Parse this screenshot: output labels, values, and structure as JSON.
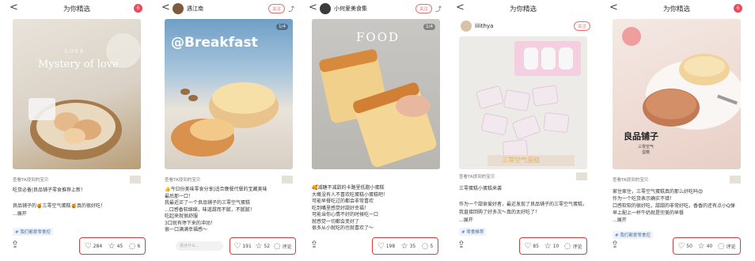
{
  "common": {
    "back": "<",
    "recommend_title": "为你精选"
  },
  "cards": [
    {
      "top_title": "为你精选",
      "badge": "6",
      "photo_text": "Mystery of love",
      "photo_sub": "LOVE",
      "count": "",
      "meta_left": "查看TA提到的宝贝",
      "desc": "吃货必备|良品铺子零食推荐上新！\n\n良品铺子的🍯三零空气蛋糕🍯真的很好吃！\n...展开",
      "tag": "# 我们都爱零食控",
      "likes": "284",
      "stars": "45",
      "comments": "6",
      "comment_placeholder": ""
    },
    {
      "username": "遇江南",
      "follow": "关注",
      "photo_text": "@Breakfast",
      "count": "1/4",
      "meta_left": "查看TA提到的宝贝",
      "desc": "👍今日份美味零食分享|适合晚餐代餐的宝藏美味\n最后那一口！\n我最近买了一个良品铺子的三零空气蛋糕\n...口感香软绵绵，味道甜而不腻，不腻腻！\n吃起来就很舒服\n3口就有停下来的冲动！\n很一口满满幸福感～",
      "tag": "",
      "likes": "191",
      "stars": "52",
      "comments": "评论",
      "comment_placeholder": "说点什么..."
    },
    {
      "username": "小何爱美食集",
      "follow": "关注",
      "photo_text": "FOOD",
      "count": "1/4",
      "meta_left": "查看TA提到的宝贝",
      "desc": "🥰减糖不减甜的卡路里低脂小蛋糕\n大概没有人不喜欢吃蛋糕小蛋糕吧！\n可能早餐吃过的都会非常喜欢\n吃到嘴里感觉好甜好幸福！\n可能当你心情不好的时候吃一口\n就感觉一切都会变好了\n很多从小就吃的也就喜欢了～",
      "tag": "",
      "likes": "198",
      "stars": "35",
      "comments": "5",
      "comment_placeholder": ""
    },
    {
      "top_title": "为你精选",
      "username": "lilithya",
      "follow": "关注",
      "photo_text": "三零空气蛋糕",
      "count": "",
      "meta_left": "查看TA提到的宝贝",
      "desc": "三零蛋糕小蛋糕来袭\n\n作为一个甜食爱好者，最近发现了良品铺子的三零空气蛋糕，\n我直接回购了好多次～真的太好吃了！\n...展开",
      "tag": "# 零食推荐",
      "likes": "85",
      "stars": "10",
      "comments": "评论",
      "comment_placeholder": ""
    },
    {
      "top_title": "为你精选",
      "badge": "6",
      "photo_text": "良品铺子",
      "photo_sub": "三零空气\n蛋糕",
      "count": "",
      "meta_left": "查看TA提到的宝贝",
      "desc": "家住家住，三零空气蛋糕真的那么好吃吗😍\n作为一个吃货表示确实不错！\n口感软软的很好吃，甜甜的非常好吃，香香的还有点小Q弹\n早上配上一杯牛奶就是完美的早餐\n...展开",
      "tag": "# 我们都爱零食控",
      "likes": "50",
      "stars": "40",
      "comments": "评论",
      "comment_placeholder": ""
    }
  ],
  "icons": {
    "like": "heart-icon",
    "star": "star-icon",
    "comment": "comment-icon",
    "share": "share-icon"
  },
  "colors": {
    "highlight_box": "#e23a3a",
    "follow": "#f26c6c",
    "badge": "#f04a5a"
  }
}
